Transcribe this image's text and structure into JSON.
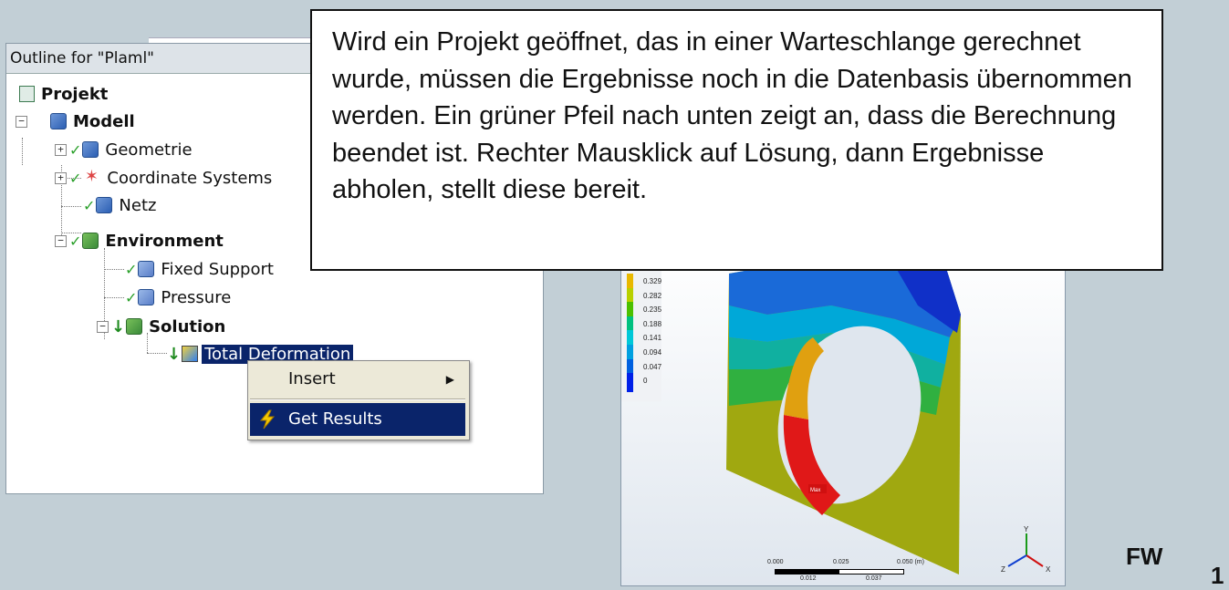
{
  "outline": {
    "title": "Outline for \"Plaml\"",
    "items": {
      "projekt": "Projekt",
      "modell": "Modell",
      "geometrie": "Geometrie",
      "coordinate_systems": "Coordinate Systems",
      "netz": "Netz",
      "environment": "Environment",
      "fixed_support": "Fixed Support",
      "pressure": "Pressure",
      "solution": "Solution",
      "total_deformation": "Total Deformation"
    }
  },
  "context_menu": {
    "insert": "Insert",
    "get_results": "Get Results"
  },
  "callout": {
    "text": "Wird ein Projekt geöffnet, das in einer Warteschlange gerechnet wurde, müssen die Ergebnisse noch in die Datenbasis übernommen werden. Ein grüner Pfeil nach unten zeigt an, dass die Berechnung beendet ist. Rechter Mausklick auf Lösung, dann Ergebnisse abholen, stellt diese bereit."
  },
  "legend": {
    "values": [
      "0.329",
      "0.282",
      "0.235",
      "0.188",
      "0.141",
      "0.094",
      "0.047",
      "0"
    ],
    "colors": [
      "#e8b800",
      "#b8d000",
      "#4cc000",
      "#00c080",
      "#00c8d8",
      "#00a0e0",
      "#0060e0",
      "#0020e8"
    ]
  },
  "viewport": {
    "max_label": "Max",
    "scale_labels": [
      "0.000",
      "0.025",
      "0.050 (m)"
    ],
    "scale_sub_labels": [
      "0.012",
      "0.037"
    ],
    "axis_labels": {
      "y": "Y",
      "z": "Z",
      "x": "X"
    }
  },
  "footer": {
    "fw": "FW",
    "page": "1"
  }
}
